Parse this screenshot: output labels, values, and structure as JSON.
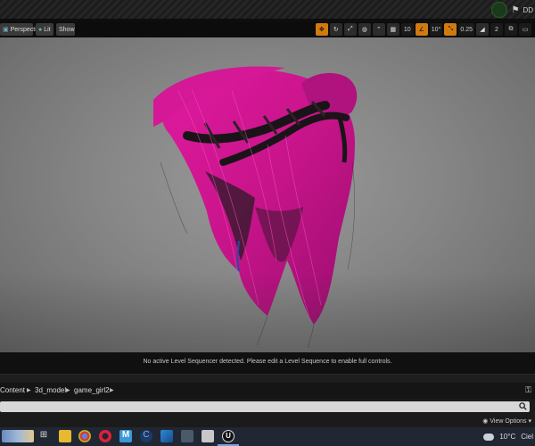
{
  "viewport_toolbar": {
    "perspective_label": "Perspective",
    "lit_label": "Lit",
    "show_label": "Show",
    "grid_snap_value": "10",
    "angle_snap_value": "10°",
    "scale_snap_value": "0.25",
    "camera_speed_value": "2"
  },
  "sequencer": {
    "message": "No active Level Sequencer detected. Please edit a Level Sequence to enable full controls."
  },
  "content_browser": {
    "breadcrumb": [
      "Content",
      "3d_model",
      "game_girl2"
    ],
    "search_value": "",
    "view_options_label": "View Options"
  },
  "taskbar": {
    "apps": [
      "file-explorer",
      "task-view",
      "folder",
      "chrome",
      "opera",
      "app-m",
      "app-c",
      "photos",
      "calculator",
      "printer",
      "unreal-engine"
    ],
    "temperature": "10°C",
    "weather_label": "Ciel"
  },
  "colors": {
    "hair_magenta": "#c8148a",
    "accent_orange": "#d07a10",
    "viewport_gray": "#8c8c8c"
  }
}
